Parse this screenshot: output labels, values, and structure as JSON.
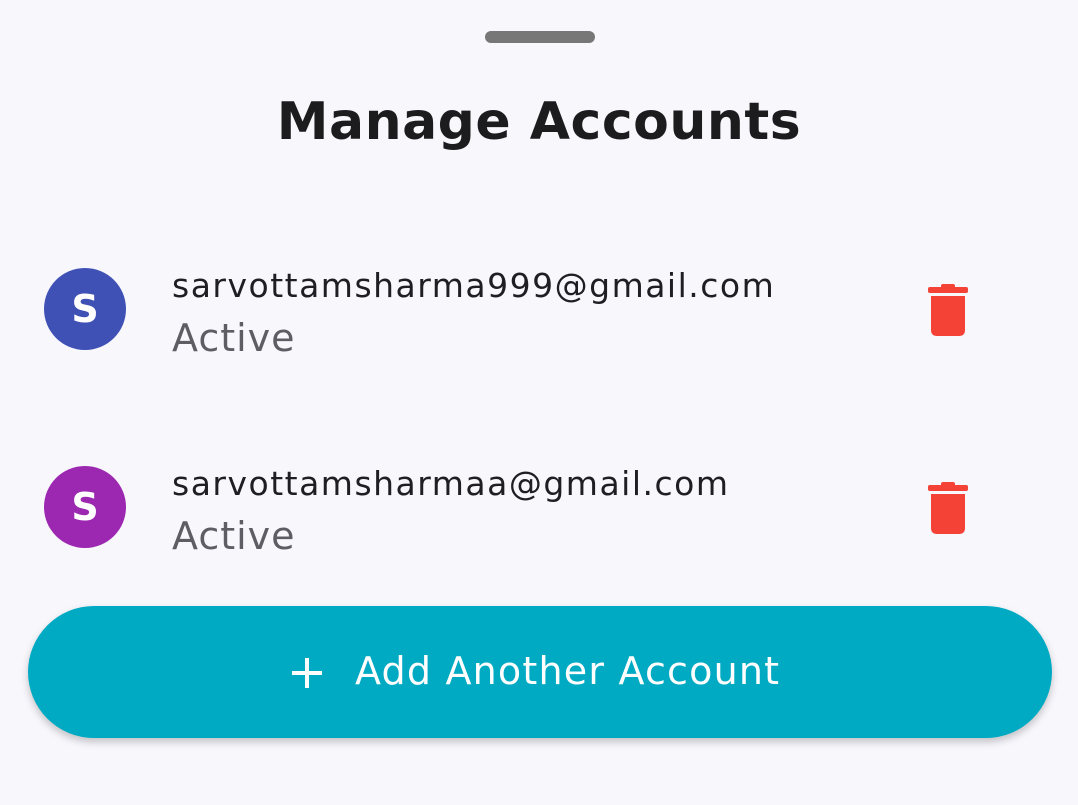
{
  "sheet": {
    "title": "Manage Accounts"
  },
  "accounts": [
    {
      "initial": "S",
      "email": "sarvottamsharma999@gmail.com",
      "status": "Active",
      "avatar_color": "#3f51b5",
      "delete_icon": "trash-icon"
    },
    {
      "initial": "S",
      "email": "sarvottamsharmaa@gmail.com",
      "status": "Active",
      "avatar_color": "#9c27b0",
      "delete_icon": "trash-icon"
    }
  ],
  "add_button": {
    "label": "Add Another Account",
    "icon": "plus-icon",
    "color": "#00aac3"
  },
  "colors": {
    "delete": "#f44336",
    "background": "#f8f7fc"
  }
}
